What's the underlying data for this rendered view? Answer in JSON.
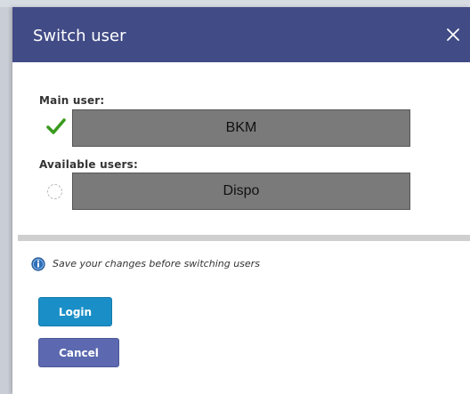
{
  "dialog": {
    "title": "Switch user",
    "close_icon": "close-icon"
  },
  "main_user": {
    "label": "Main user:",
    "name": "BKM",
    "selected": true,
    "indicator_icon": "checkmark-icon",
    "indicator_color": "#3a9a1e"
  },
  "available_users": {
    "label": "Available users:",
    "items": [
      {
        "name": "Dispo",
        "selected": false,
        "indicator_icon": "radio-unselected-icon"
      }
    ]
  },
  "notice": {
    "icon": "info-icon",
    "text": "Save your changes before switching users"
  },
  "actions": {
    "login_label": "Login",
    "cancel_label": "Cancel"
  },
  "colors": {
    "header": "#414b86",
    "login_button": "#1a8fc7",
    "cancel_button": "#5c69b0",
    "user_box": "#7a7a7a"
  }
}
